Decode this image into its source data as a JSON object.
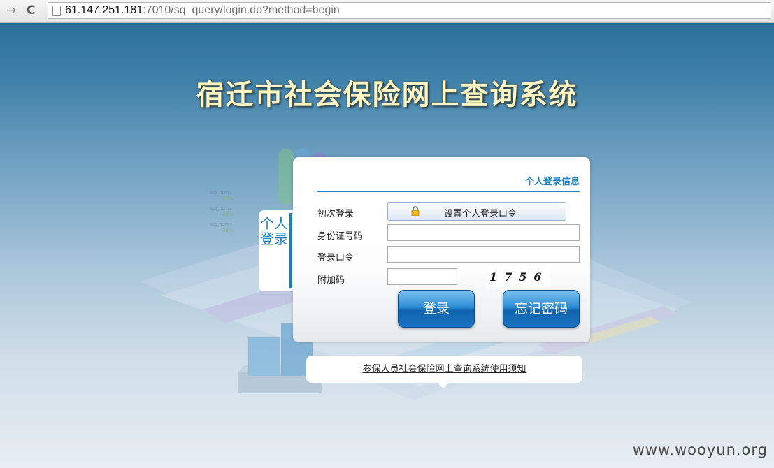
{
  "browser": {
    "url_host": "61.147.251.181",
    "url_rest": ":7010/sq_query/login.do?method=begin"
  },
  "page": {
    "title": "宿迁市社会保险网上查询系统",
    "side_tab": "个人登录",
    "watermark": "www.wooyun.org"
  },
  "login": {
    "header": "个人登录信息",
    "first_login_label": "初次登录",
    "set_password_button": "设置个人登录口令",
    "id_label": "身份证号码",
    "id_value": "",
    "password_label": "登录口令",
    "password_value": "",
    "code_label": "附加码",
    "code_value": "",
    "captcha": "1756",
    "login_button": "登录",
    "forgot_button": "忘记密码"
  },
  "notice": {
    "link": "参保人员社会保险网上查询系统使用须知"
  },
  "colors": {
    "accent": "#1f7fc0",
    "title": "#fdf5c4"
  }
}
